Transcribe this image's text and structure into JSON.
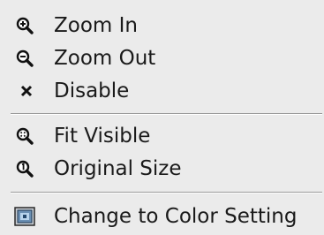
{
  "menu": {
    "items": [
      {
        "label": "Zoom In",
        "icon": "zoom-in-icon"
      },
      {
        "label": "Zoom Out",
        "icon": "zoom-out-icon"
      },
      {
        "label": "Disable",
        "icon": "close-x-icon"
      },
      {
        "label": "Fit Visible",
        "icon": "zoom-fit-icon"
      },
      {
        "label": "Original Size",
        "icon": "zoom-original-icon"
      },
      {
        "label": "Change to Color Setting",
        "icon": "color-setting-icon"
      }
    ]
  }
}
